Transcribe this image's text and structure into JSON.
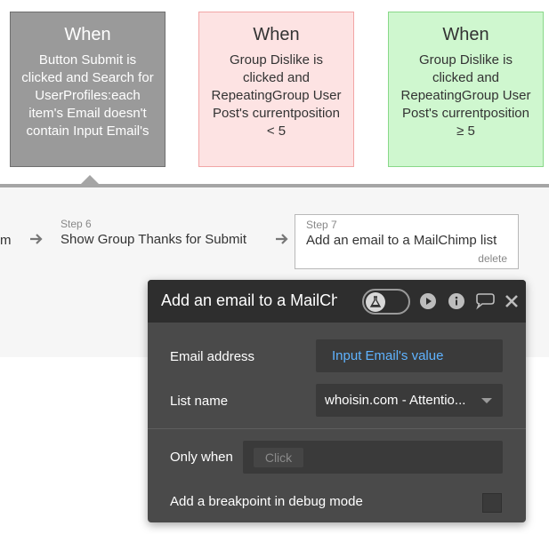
{
  "events": [
    {
      "when_label": "When",
      "description": "Button Submit is clicked and Search for UserProfiles:each item's Email doesn't contain Input Email's",
      "color": "#9a9a9a"
    },
    {
      "when_label": "When",
      "description": "Group Dislike is clicked and RepeatingGroup User Post's currentposition < 5",
      "color": "#fde3e3"
    },
    {
      "when_label": "When",
      "description": "Group Dislike is clicked and RepeatingGroup User Post's currentposition ≥ 5",
      "color": "#cff7cf"
    }
  ],
  "workflow": {
    "partial_prev_step": "m",
    "step6": {
      "number": "Step 6",
      "title": "Show Group Thanks for Submit"
    },
    "step7": {
      "number": "Step 7",
      "title": "Add an email to a MailChimp list",
      "delete_label": "delete"
    }
  },
  "panel": {
    "title": "Add an email to a MailChimp list",
    "icons": [
      "debug-flask-icon",
      "play-icon",
      "info-icon",
      "comment-icon",
      "close-icon"
    ],
    "email_label": "Email address",
    "email_value": "Input Email's value",
    "list_label": "List name",
    "list_value": "whoisin.com - Attentio...",
    "only_when_label": "Only when",
    "only_when_placeholder": "Click",
    "breakpoint_label": "Add a breakpoint in debug mode",
    "accent_color": "#5fb3ff"
  }
}
